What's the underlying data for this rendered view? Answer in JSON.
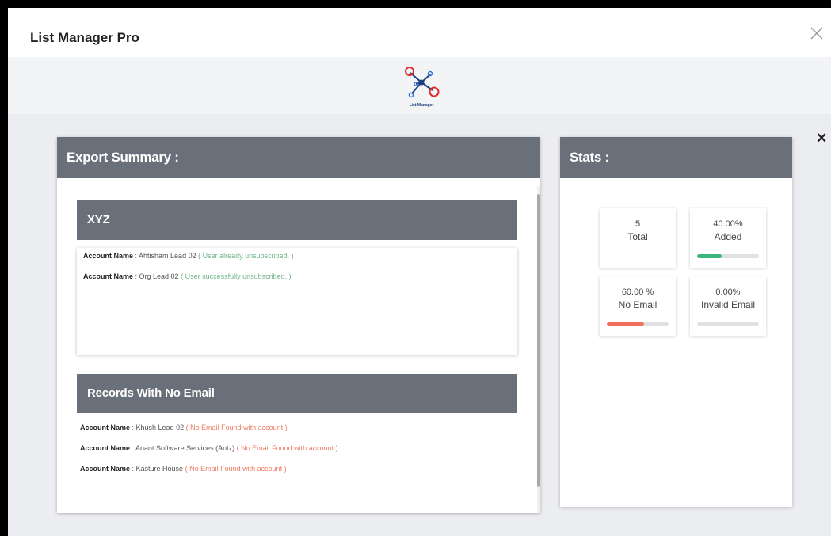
{
  "window": {
    "title": "List Manager Pro"
  },
  "logo": {
    "text": "List Manager"
  },
  "export_summary": {
    "title": "Export Summary :",
    "group": {
      "name": "XYZ",
      "records": [
        {
          "label": "Account Name",
          "value": "Ahtisham Lead 02",
          "status": "( User already unsubscribed. )"
        },
        {
          "label": "Account Name",
          "value": "Org Lead 02",
          "status": "( User successfully unsubscribed. )"
        }
      ]
    },
    "no_email": {
      "title": "Records With No Email",
      "records": [
        {
          "label": "Account Name",
          "value": "Khush Lead 02",
          "status": "( No Email Found with account )"
        },
        {
          "label": "Account Name",
          "value": "Anant Software Services (Antz)",
          "status": "( No Email Found with account )"
        },
        {
          "label": "Account Name",
          "value": "Kasture House",
          "status": "( No Email Found with account )"
        }
      ]
    }
  },
  "stats": {
    "title": "Stats :",
    "cards": [
      {
        "value": "5",
        "label": "Total",
        "progress": null,
        "color": null
      },
      {
        "value": "40.00%",
        "label": "Added",
        "progress": 0.4,
        "color": "#3bb77e"
      },
      {
        "value": "60.00 %",
        "label": "No Email",
        "progress": 0.6,
        "color": "#f0705a"
      },
      {
        "value": "0.00%",
        "label": "Invalid Email",
        "progress": 0.0,
        "color": "#3bb77e"
      }
    ]
  },
  "colors": {
    "header": "#697079",
    "success": "#6fb48a",
    "error": "#ef7b63"
  }
}
